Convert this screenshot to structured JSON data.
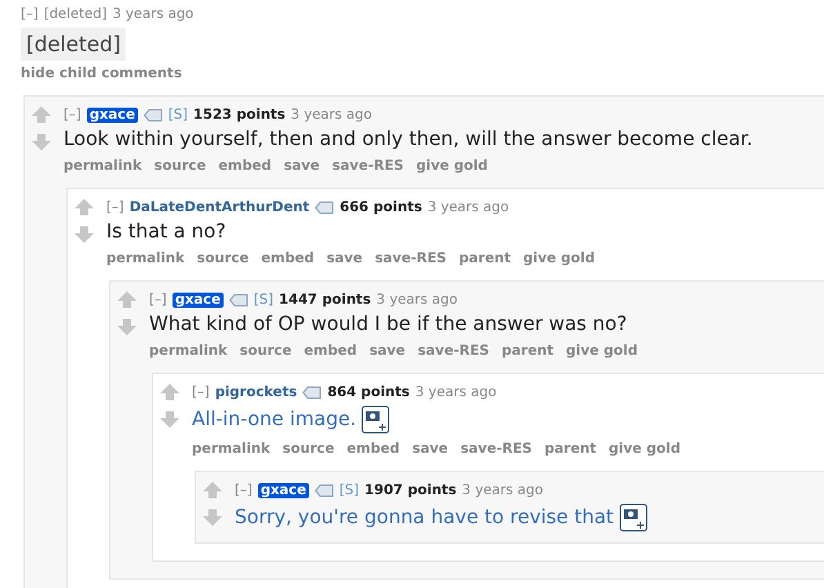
{
  "root": {
    "toggle": "[–]",
    "author": "[deleted]",
    "time": "3 years ago",
    "body": "[deleted]",
    "hide_link": "hide child comments"
  },
  "comments": [
    {
      "toggle": "[–]",
      "author": "gxace",
      "op": true,
      "flair": "[S]",
      "points": "1523 points",
      "time": "3 years ago",
      "body": "Look within yourself, then and only then, will the answer become clear.",
      "link": false,
      "actions": [
        "permalink",
        "source",
        "embed",
        "save",
        "save-RES",
        "give gold"
      ],
      "children": [
        {
          "toggle": "[–]",
          "author": "DaLateDentArthurDent",
          "op": false,
          "points": "666 points",
          "time": "3 years ago",
          "body": "Is that a no?",
          "link": false,
          "actions": [
            "permalink",
            "source",
            "embed",
            "save",
            "save-RES",
            "parent",
            "give gold"
          ],
          "children": [
            {
              "toggle": "[–]",
              "author": "gxace",
              "op": true,
              "flair": "[S]",
              "points": "1447 points",
              "time": "3 years ago",
              "body": "What kind of OP would I be if the answer was no?",
              "link": false,
              "actions": [
                "permalink",
                "source",
                "embed",
                "save",
                "save-RES",
                "parent",
                "give gold"
              ],
              "children": [
                {
                  "toggle": "[–]",
                  "author": "pigrockets",
                  "op": false,
                  "points": "864 points",
                  "time": "3 years ago",
                  "body": "All-in-one image.",
                  "link": true,
                  "actions": [
                    "permalink",
                    "source",
                    "embed",
                    "save",
                    "save-RES",
                    "parent",
                    "give gold"
                  ],
                  "children": [
                    {
                      "toggle": "[–]",
                      "author": "gxace",
                      "op": true,
                      "flair": "[S]",
                      "points": "1907 points",
                      "time": "3 years ago",
                      "body": "Sorry, you're gonna have to revise that",
                      "link": true
                    }
                  ]
                }
              ]
            }
          ]
        }
      ]
    }
  ]
}
